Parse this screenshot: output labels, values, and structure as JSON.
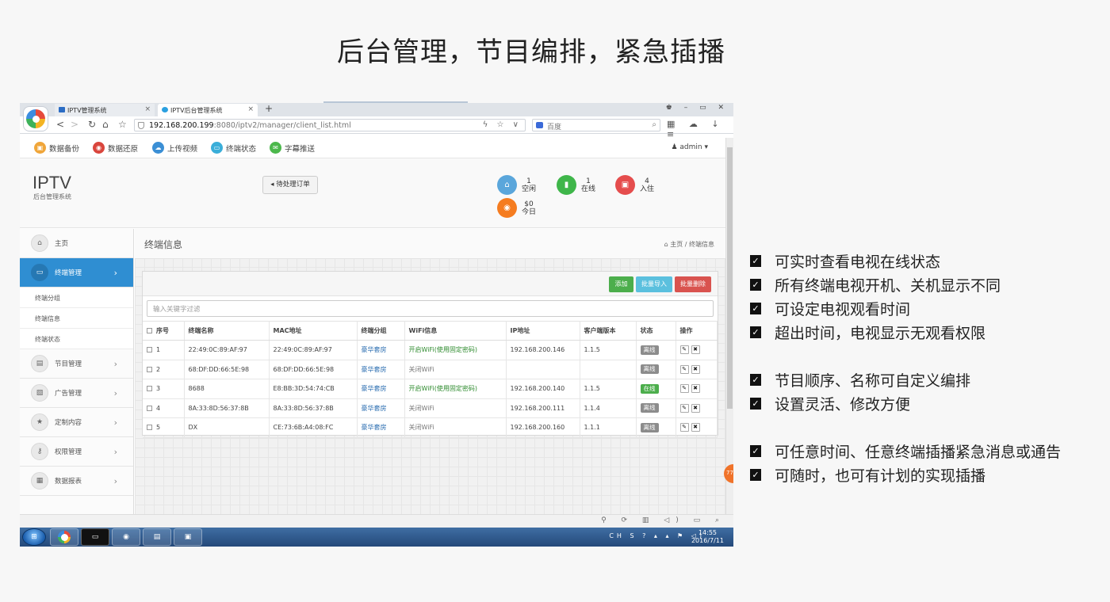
{
  "headline": "后台管理，节目编排，紧急插播",
  "browser": {
    "tabs": [
      {
        "label": "IPTV管理系统"
      },
      {
        "label": "IPTV后台管理系统"
      }
    ],
    "new_tab": "+",
    "window_controls": "♚ – ▭ ✕",
    "url_host": "192.168.200.199",
    "url_rest": ":8080/iptv2/manager/client_list.html",
    "url_icons": "ϟ ☆ ∨",
    "search_placeholder": "百度",
    "search_icon": "⌕",
    "tool_icons": "▦ ☁ ↓ ≡",
    "nav_back": "<",
    "nav_forward": ">",
    "nav_reload": "↻",
    "nav_home": "⌂",
    "nav_star": "☆"
  },
  "topnav": {
    "items": [
      {
        "label": "数据备份",
        "color": "#f0a63a",
        "icon": "▣"
      },
      {
        "label": "数据还原",
        "color": "#d9453c",
        "icon": "◉"
      },
      {
        "label": "上传视频",
        "color": "#3b8fd5",
        "icon": "☁"
      },
      {
        "label": "终端状态",
        "color": "#3aaed9",
        "icon": "▭"
      },
      {
        "label": "字幕推送",
        "color": "#4cb84c",
        "icon": "✉"
      }
    ],
    "user": "admin ▾"
  },
  "header": {
    "brand": "IPTV",
    "brand_sub": "后台管理系统",
    "orders_button": "待处理订单",
    "stats": [
      {
        "value": "1",
        "label": "空闲",
        "color": "#5aa6db",
        "icon": "⌂"
      },
      {
        "value": "1",
        "label": "在线",
        "color": "#3fb64a",
        "icon": "▮"
      },
      {
        "value": "4",
        "label": "入住",
        "color": "#e54d4d",
        "icon": "▣"
      },
      {
        "value": "$0",
        "label": "今日",
        "color": "#f57c20",
        "icon": "◉"
      }
    ]
  },
  "sidebar": {
    "items": [
      {
        "label": "主页",
        "icon": "⌂",
        "active": false
      },
      {
        "label": "终端管理",
        "icon": "▭",
        "active": true
      },
      {
        "label": "节目管理",
        "icon": "▤",
        "active": false
      },
      {
        "label": "广告管理",
        "icon": "▧",
        "active": false
      },
      {
        "label": "定制内容",
        "icon": "★",
        "active": false
      },
      {
        "label": "权限管理",
        "icon": "⚷",
        "active": false
      },
      {
        "label": "数据报表",
        "icon": "▦",
        "active": false
      }
    ],
    "subitems": [
      "终端分组",
      "终端信息",
      "终端状态"
    ]
  },
  "content": {
    "title": "终端信息",
    "crumb_home": "主页",
    "crumb_sep": "/",
    "crumb_current": "终端信息",
    "buttons": {
      "add": "添加",
      "import": "批量导入",
      "delete": "批量删除"
    },
    "filter_placeholder": "输入关键字过滤",
    "columns": [
      "序号",
      "终端名称",
      "MAC地址",
      "终端分组",
      "WiFi信息",
      "IP地址",
      "客户端版本",
      "状态",
      "操作"
    ],
    "rows": [
      {
        "no": "1",
        "name": "22:49:0C:89:AF:97",
        "mac": "22:49:0C:89:AF:97",
        "group": "豪华套房",
        "wifi": "开启WiFi(使用固定密码)",
        "wifi_on": true,
        "ip": "192.168.200.146",
        "ver": "1.1.5",
        "status": "离线",
        "online": false
      },
      {
        "no": "2",
        "name": "68:DF:DD:66:5E:98",
        "mac": "68:DF:DD:66:5E:98",
        "group": "豪华套房",
        "wifi": "关闭WiFi",
        "wifi_on": false,
        "ip": "",
        "ver": "",
        "status": "离线",
        "online": false
      },
      {
        "no": "3",
        "name": "8688",
        "mac": "E8:BB:3D:54:74:CB",
        "group": "豪华套房",
        "wifi": "开启WiFi(使用固定密码)",
        "wifi_on": true,
        "ip": "192.168.200.140",
        "ver": "1.1.5",
        "status": "在线",
        "online": true
      },
      {
        "no": "4",
        "name": "8A:33:8D:56:37:8B",
        "mac": "8A:33:8D:56:37:8B",
        "group": "豪华套房",
        "wifi": "关闭WiFi",
        "wifi_on": false,
        "ip": "192.168.200.111",
        "ver": "1.1.4",
        "status": "离线",
        "online": false
      },
      {
        "no": "5",
        "name": "DX",
        "mac": "CE:73:6B:A4:08:FC",
        "group": "豪华套房",
        "wifi": "关闭WiFi",
        "wifi_on": false,
        "ip": "192.168.200.160",
        "ver": "1.1.1",
        "status": "离线",
        "online": false
      }
    ]
  },
  "float_badge": "77",
  "statusbar_icons": "⚲ ⟳ ▥ ◁) ▭ ⌕",
  "taskbar": {
    "tray": "CH S ? ▴ ▴ ⚑ ◁)",
    "time": "14:55",
    "date": "2016/7/11"
  },
  "features": [
    "可实时查看电视在线状态",
    "所有终端电视开机、关机显示不同",
    "可设定电视观看时间",
    "超出时间，电视显示无观看权限",
    "",
    "节目顺序、名称可自定义编排",
    "设置灵活、修改方便",
    "",
    "可任意时间、任意终端插播紧急消息或通告",
    "可随时，也可有计划的实现插播"
  ]
}
